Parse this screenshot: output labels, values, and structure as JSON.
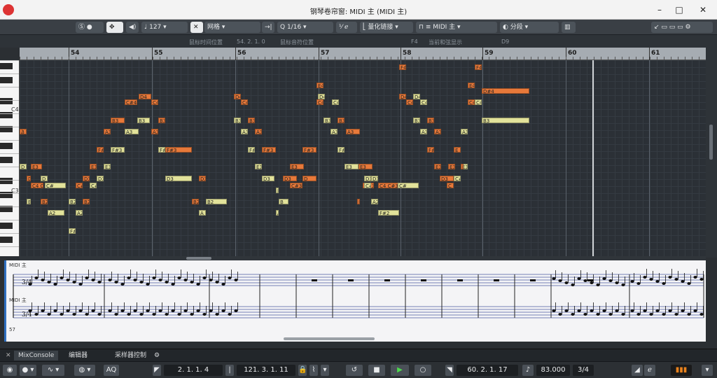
{
  "window": {
    "title": "钢琴卷帘窗: MIDI 主 (MIDI 主)"
  },
  "toolbar": {
    "velocity": "127",
    "snap_mode": "网格",
    "quantize": "1/16",
    "quantize_link": "量化链接",
    "midi_track": "MIDI 主",
    "segment": "分段"
  },
  "info": {
    "mouse_time_label": "鼠标时间位置",
    "mouse_time_value": "54. 2. 1. 0",
    "mouse_note_label": "鼠标音符位置",
    "mouse_note_value": "F4",
    "chord_label": "当前和弦显示",
    "chord_value": "D9"
  },
  "ruler": {
    "bars": [
      "54",
      "55",
      "56",
      "57",
      "58",
      "59",
      "60",
      "61"
    ]
  },
  "keyboard": {
    "c4": "C4",
    "c3": "C3"
  },
  "notes": [
    {
      "t": "F4",
      "c": "o"
    },
    {
      "t": "F4",
      "c": "o"
    },
    {
      "t": "E4",
      "c": "o"
    },
    {
      "t": "E4",
      "c": "o"
    },
    {
      "t": "D4",
      "c": "o"
    },
    {
      "t": "D4",
      "c": "o"
    },
    {
      "t": "D4",
      "c": "y"
    },
    {
      "t": "D4",
      "c": "o"
    },
    {
      "t": "D#4",
      "c": "o"
    },
    {
      "t": "D4",
      "c": "y"
    },
    {
      "t": "C#4",
      "c": "o"
    },
    {
      "t": "C4",
      "c": "o"
    },
    {
      "t": "C4",
      "c": "o"
    },
    {
      "t": "C4",
      "c": "o"
    },
    {
      "t": "C4",
      "c": "y"
    },
    {
      "t": "C4",
      "c": "o"
    },
    {
      "t": "C4",
      "c": "y"
    },
    {
      "t": "C4",
      "c": "o"
    },
    {
      "t": "C4",
      "c": "y"
    },
    {
      "t": "B3",
      "c": "o"
    },
    {
      "t": "B3",
      "c": "y"
    },
    {
      "t": "B3",
      "c": "o"
    },
    {
      "t": "B3",
      "c": "y"
    },
    {
      "t": "B3",
      "c": "o"
    },
    {
      "t": "B3",
      "c": "y"
    },
    {
      "t": "B3",
      "c": "o"
    },
    {
      "t": "B3",
      "c": "y"
    },
    {
      "t": "B3",
      "c": "o"
    },
    {
      "t": "B3",
      "c": "y"
    },
    {
      "t": "B",
      "c": "o"
    },
    {
      "t": "A3",
      "c": "o"
    },
    {
      "t": "A3",
      "c": "y"
    },
    {
      "t": "A3",
      "c": "o"
    },
    {
      "t": "A3",
      "c": "y"
    },
    {
      "t": "A3",
      "c": "o"
    },
    {
      "t": "A3",
      "c": "y"
    },
    {
      "t": "A3",
      "c": "o"
    },
    {
      "t": "A3",
      "c": "y"
    },
    {
      "t": "A3",
      "c": "o"
    },
    {
      "t": "A3",
      "c": "y"
    },
    {
      "t": "A3",
      "c": "o"
    },
    {
      "t": "F#",
      "c": "o"
    },
    {
      "t": "F#3",
      "c": "y"
    },
    {
      "t": "F#3",
      "c": "o"
    },
    {
      "t": "F#",
      "c": "y"
    },
    {
      "t": "F#3",
      "c": "o"
    },
    {
      "t": "F#3",
      "c": "o"
    },
    {
      "t": "F#",
      "c": "y"
    },
    {
      "t": "F#",
      "c": "y"
    },
    {
      "t": "E",
      "c": "o"
    },
    {
      "t": "F#",
      "c": "o"
    },
    {
      "t": "D",
      "c": "y"
    },
    {
      "t": "E3",
      "c": "o"
    },
    {
      "t": "E3",
      "c": "o"
    },
    {
      "t": "E3",
      "c": "y"
    },
    {
      "t": "E3",
      "c": "y"
    },
    {
      "t": "E3",
      "c": "o"
    },
    {
      "t": "E3",
      "c": "y"
    },
    {
      "t": "E3",
      "c": "o"
    },
    {
      "t": "E3",
      "c": "o"
    },
    {
      "t": "E3",
      "c": "y"
    },
    {
      "t": "E3",
      "c": "o"
    },
    {
      "t": "E3",
      "c": "y"
    },
    {
      "t": "D",
      "c": "o"
    },
    {
      "t": "D3",
      "c": "o"
    },
    {
      "t": "D",
      "c": "y"
    },
    {
      "t": "D3",
      "c": "o"
    },
    {
      "t": "D3",
      "c": "y"
    },
    {
      "t": "D3",
      "c": "y"
    },
    {
      "t": "D3",
      "c": "o"
    },
    {
      "t": "D3",
      "c": "y"
    },
    {
      "t": "D3",
      "c": "o"
    },
    {
      "t": "D",
      "c": "o"
    },
    {
      "t": "D3",
      "c": "y"
    },
    {
      "t": "D3",
      "c": "y"
    },
    {
      "t": "D3",
      "c": "o"
    },
    {
      "t": "C#3",
      "c": "y"
    },
    {
      "t": "C4 C#3",
      "c": "o"
    },
    {
      "t": "C#",
      "c": "y"
    },
    {
      "t": "C#",
      "c": "o"
    },
    {
      "t": "C#",
      "c": "y"
    },
    {
      "t": "C#3",
      "c": "o"
    },
    {
      "t": "C#3",
      "c": "y"
    },
    {
      "t": "C#3",
      "c": "o"
    },
    {
      "t": "C4 C#3",
      "c": "o"
    },
    {
      "t": "C#",
      "c": "y"
    },
    {
      "t": "C",
      "c": "o"
    },
    {
      "t": "B",
      "c": "y"
    },
    {
      "t": "B2",
      "c": "y"
    },
    {
      "t": "B2",
      "c": "o"
    },
    {
      "t": "B2",
      "c": "y"
    },
    {
      "t": "B2",
      "c": "o"
    },
    {
      "t": "B2",
      "c": "o"
    },
    {
      "t": "B2",
      "c": "y"
    },
    {
      "t": "B",
      "c": "y"
    },
    {
      "t": "B2",
      "c": "o"
    },
    {
      "t": "A2 A2",
      "c": "y"
    },
    {
      "t": "A2",
      "c": "y"
    },
    {
      "t": "A2",
      "c": "y"
    },
    {
      "t": "A",
      "c": "y"
    },
    {
      "t": "A2 A2",
      "c": "y"
    },
    {
      "t": "F#2",
      "c": "y"
    },
    {
      "t": "F#2",
      "c": "y"
    }
  ],
  "score": {
    "track_label": "MIDI 主",
    "lower_label": "MIDI 主",
    "measure_num": "57",
    "time_sig": "3/4"
  },
  "tabs": {
    "mixconsole": "MixConsole",
    "editor": "编辑器",
    "sampler": "采样器控制"
  },
  "transport": {
    "left_locator": "2. 1. 1.   4",
    "position": "121. 3. 1. 11",
    "right_locator": "60.   2. 1. 17",
    "tempo": "83.000",
    "signature": "3/4",
    "aq_label": "AQ"
  }
}
